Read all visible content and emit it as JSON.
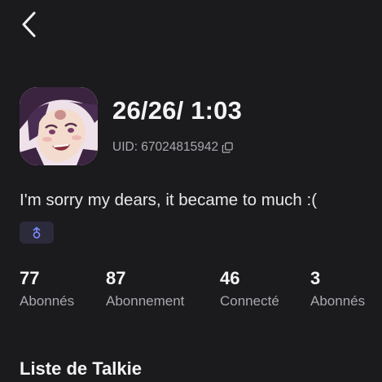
{
  "header": {
    "back_icon": "chevron-left-icon"
  },
  "profile": {
    "avatar_description": "anime-character-avatar",
    "username": "26/26/ 1:03",
    "uid": "UID: 67024815942",
    "copy_icon": "copy-icon",
    "bio": "I'm sorry my dears, it became to much :(",
    "badge_icon": "gender-symbol-icon"
  },
  "stats": [
    {
      "value": "77",
      "label": "Abonnés"
    },
    {
      "value": "87",
      "label": "Abonnement"
    },
    {
      "value": "46",
      "label": "Connecté"
    },
    {
      "value": "3",
      "label": "Abonnés"
    }
  ],
  "section": {
    "title": "Liste de Talkie"
  },
  "colors": {
    "background": "#1b1a1d",
    "text_primary": "#f4f4f4",
    "text_secondary": "#a9a8ad",
    "badge_bg": "#2c2b3c",
    "badge_icon": "#7b8cff"
  }
}
